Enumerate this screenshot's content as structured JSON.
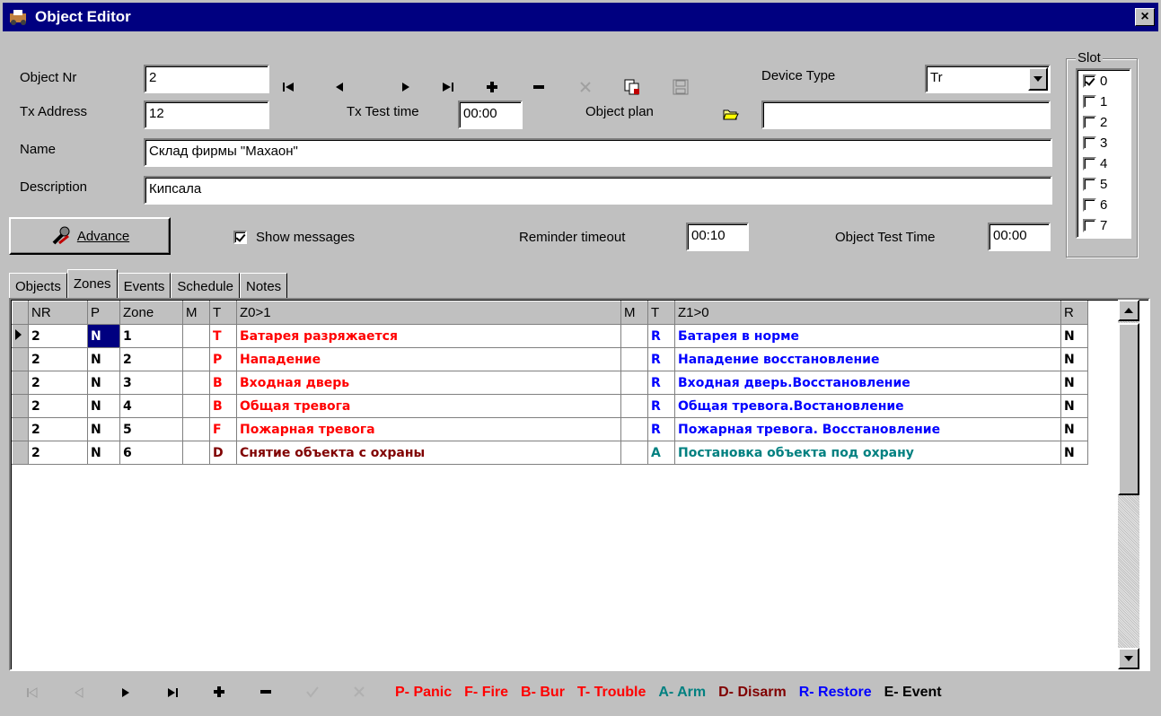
{
  "window": {
    "title": "Object Editor",
    "close": "×"
  },
  "form": {
    "object_nr_label": "Object Nr",
    "object_nr_value": "2",
    "tx_address_label": "Tx Address",
    "tx_address_value": "12",
    "tx_test_time_label": "Tx Test time",
    "tx_test_time_value": "00:00",
    "object_plan_label": "Object plan",
    "object_plan_value": "",
    "device_type_label": "Device Type",
    "device_type_value": "Tr",
    "name_label": "Name",
    "name_value": "Склад фирмы \"Махаон\"",
    "description_label": "Description",
    "description_value": "Кипсала",
    "advance_label": "Advance",
    "show_messages_label": "Show messages",
    "show_messages_checked": true,
    "reminder_timeout_label": "Reminder timeout",
    "reminder_timeout_value": "00:10",
    "object_test_time_label": "Object Test Time",
    "object_test_time_value": "00:00"
  },
  "slot": {
    "title": "Slot",
    "items": [
      {
        "label": "0",
        "checked": true
      },
      {
        "label": "1",
        "checked": false
      },
      {
        "label": "2",
        "checked": false
      },
      {
        "label": "3",
        "checked": false
      },
      {
        "label": "4",
        "checked": false
      },
      {
        "label": "5",
        "checked": false
      },
      {
        "label": "6",
        "checked": false
      },
      {
        "label": "7",
        "checked": false
      }
    ]
  },
  "tabs": [
    "Objects",
    "Zones",
    "Events",
    "Schedule",
    "Notes"
  ],
  "active_tab": "Zones",
  "grid": {
    "headers": [
      "NR",
      "P",
      "Zone",
      "M",
      "T",
      "Z0>1",
      "M",
      "T",
      "Z1>0",
      "R"
    ],
    "rows": [
      {
        "nr": "2",
        "p": "N",
        "zone": "1",
        "m1": "",
        "t1": "T",
        "z01": "Батарея разряжается",
        "m2": "",
        "t2": "R",
        "z10": "Батарея в норме",
        "r": "N",
        "c1": "#ff0000",
        "c2": "#0000ff"
      },
      {
        "nr": "2",
        "p": "N",
        "zone": "2",
        "m1": "",
        "t1": "P",
        "z01": "Нападение",
        "m2": "",
        "t2": "R",
        "z10": "Нападение восстановление",
        "r": "N",
        "c1": "#ff0000",
        "c2": "#0000ff"
      },
      {
        "nr": "2",
        "p": "N",
        "zone": "3",
        "m1": "",
        "t1": "B",
        "z01": "Входная дверь",
        "m2": "",
        "t2": "R",
        "z10": "Входная дверь.Восстановление",
        "r": "N",
        "c1": "#ff0000",
        "c2": "#0000ff"
      },
      {
        "nr": "2",
        "p": "N",
        "zone": "4",
        "m1": "",
        "t1": "B",
        "z01": "Общая тревога",
        "m2": "",
        "t2": "R",
        "z10": "Общая тревога.Востановление",
        "r": "N",
        "c1": "#ff0000",
        "c2": "#0000ff"
      },
      {
        "nr": "2",
        "p": "N",
        "zone": "5",
        "m1": "",
        "t1": "F",
        "z01": "Пожарная тревога",
        "m2": "",
        "t2": "R",
        "z10": "Пожарная тревога. Восстановление",
        "r": "N",
        "c1": "#ff0000",
        "c2": "#0000ff"
      },
      {
        "nr": "2",
        "p": "N",
        "zone": "6",
        "m1": "",
        "t1": "D",
        "z01": "Снятие объекта с охраны",
        "m2": "",
        "t2": "A",
        "z10": "Постановка объекта под охрану",
        "r": "N",
        "c1": "#800000",
        "c2": "#008080"
      }
    ]
  },
  "legend": [
    {
      "text": "P- Panic",
      "color": "#ff0000"
    },
    {
      "text": "F- Fire",
      "color": "#ff0000"
    },
    {
      "text": "B- Bur",
      "color": "#ff0000"
    },
    {
      "text": "T- Trouble",
      "color": "#ff0000"
    },
    {
      "text": "A- Arm",
      "color": "#008080"
    },
    {
      "text": "D- Disarm",
      "color": "#800000"
    },
    {
      "text": "R- Restore",
      "color": "#0000ff"
    },
    {
      "text": "E- Event",
      "color": "#000000"
    }
  ]
}
